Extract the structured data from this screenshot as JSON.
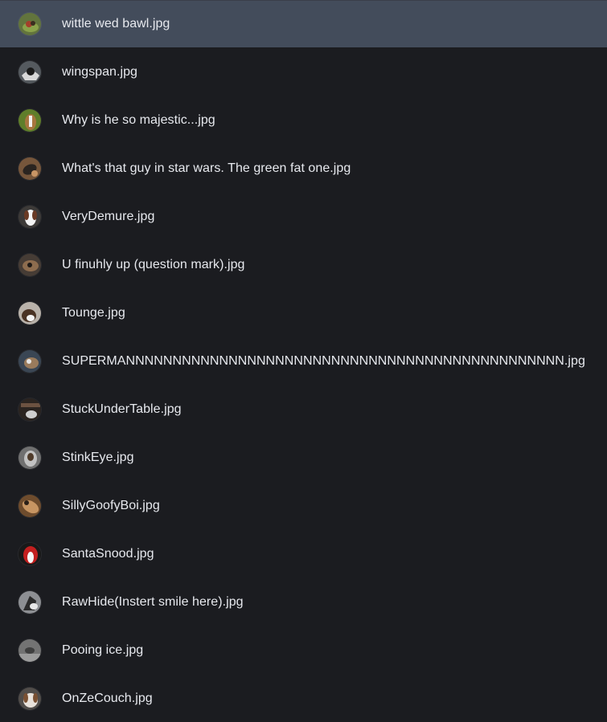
{
  "files": [
    {
      "name": "wittle wed bawl.jpg",
      "selected": true,
      "thumb": {
        "bg": "#62743d",
        "fg": "#8aa24a",
        "accent": "#a33f2b"
      }
    },
    {
      "name": "wingspan.jpg",
      "selected": false,
      "thumb": {
        "bg": "#555a5f",
        "fg": "#d8d8d8",
        "accent": "#1b1b1b"
      }
    },
    {
      "name": "Why is he so majestic...jpg",
      "selected": false,
      "thumb": {
        "bg": "#5f7e2a",
        "fg": "#a7763f",
        "accent": "#f1f1f1"
      }
    },
    {
      "name": "What's that guy in star wars. The green fat one.jpg",
      "selected": false,
      "thumb": {
        "bg": "#76563b",
        "fg": "#2a2420",
        "accent": "#c89565"
      }
    },
    {
      "name": "VeryDemure.jpg",
      "selected": false,
      "thumb": {
        "bg": "#3d3a38",
        "fg": "#f3f3f3",
        "accent": "#6a3a24"
      }
    },
    {
      "name": "U finuhly up (question mark).jpg",
      "selected": false,
      "thumb": {
        "bg": "#463c35",
        "fg": "#8d6c4e",
        "accent": "#1e1a17"
      }
    },
    {
      "name": "Tounge.jpg",
      "selected": false,
      "thumb": {
        "bg": "#b9b2aa",
        "fg": "#4a3324",
        "accent": "#f4f4f4"
      }
    },
    {
      "name": "SUPERMANNNNNNNNNNNNNNNNNNNNNNNNNNNNNNNNNNNNNNNNNNNNNNN.jpg",
      "selected": false,
      "thumb": {
        "bg": "#3a4654",
        "fg": "#9a7b5c",
        "accent": "#e6e6e6"
      }
    },
    {
      "name": "StuckUnderTable.jpg",
      "selected": false,
      "thumb": {
        "bg": "#2b2420",
        "fg": "#6c5241",
        "accent": "#cfcfcf"
      }
    },
    {
      "name": "StinkEye.jpg",
      "selected": false,
      "thumb": {
        "bg": "#707070",
        "fg": "#c2c2c2",
        "accent": "#4f3b2a"
      }
    },
    {
      "name": "SillyGoofyBoi.jpg",
      "selected": false,
      "thumb": {
        "bg": "#6e4c2d",
        "fg": "#c79562",
        "accent": "#2a1f17"
      }
    },
    {
      "name": "SantaSnood.jpg",
      "selected": false,
      "thumb": {
        "bg": "#191919",
        "fg": "#c31f1f",
        "accent": "#f6f6f6"
      }
    },
    {
      "name": "RawHide(Instert smile here).jpg",
      "selected": false,
      "thumb": {
        "bg": "#8d8f93",
        "fg": "#2b2b2b",
        "accent": "#e7e7e7"
      }
    },
    {
      "name": "Pooing ice.jpg",
      "selected": false,
      "thumb": {
        "bg": "#737373",
        "fg": "#9c9c9c",
        "accent": "#3f3f3f"
      }
    },
    {
      "name": "OnZeCouch.jpg",
      "selected": false,
      "thumb": {
        "bg": "#514d4a",
        "fg": "#e8e1da",
        "accent": "#7a5032"
      }
    }
  ]
}
